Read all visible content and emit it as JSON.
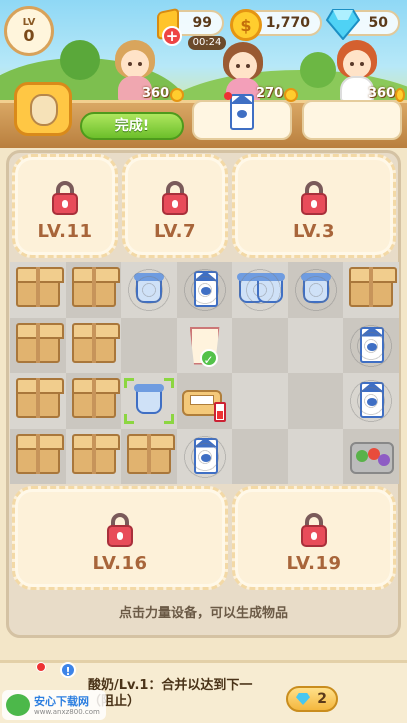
{
  "hud": {
    "level_label": "LV",
    "level": "0",
    "energy": "99",
    "energy_timer": "00:24",
    "coins": "1,770",
    "gems": "50"
  },
  "orders": [
    {
      "reward": "360"
    },
    {
      "reward": "270"
    },
    {
      "reward": "360"
    }
  ],
  "complete_button": "完成!",
  "board": {
    "locked_top": [
      "LV.11",
      "LV.7",
      "LV.3"
    ],
    "locked_bottom": [
      "LV.16",
      "LV.19"
    ],
    "items": [
      [
        "box",
        "box",
        "yogurt-web",
        "milk-web",
        "yogurt2-web",
        "yogurt-web",
        "box"
      ],
      [
        "box",
        "box",
        "empty",
        "cup",
        "empty",
        "empty",
        "milk-web"
      ],
      [
        "box",
        "box",
        "yogurt-hint",
        "scale",
        "empty",
        "empty",
        "milk-web"
      ],
      [
        "box",
        "box",
        "box",
        "milk-web",
        "empty",
        "empty",
        "veg"
      ]
    ]
  },
  "instruction": "点击力量设备，可以生成物品",
  "selected_item": {
    "description": "酸奶/Lv.1：合并以达到下一（阻止）",
    "gem_cost": "2"
  },
  "watermark": {
    "title": "安心下载网",
    "url": "www.anxz800.com"
  },
  "colors": {
    "accent_green": "#6cbf2b",
    "coin_gold": "#ffcd2e",
    "lock_red": "#e84c5a",
    "label_brown": "#a8653a"
  }
}
